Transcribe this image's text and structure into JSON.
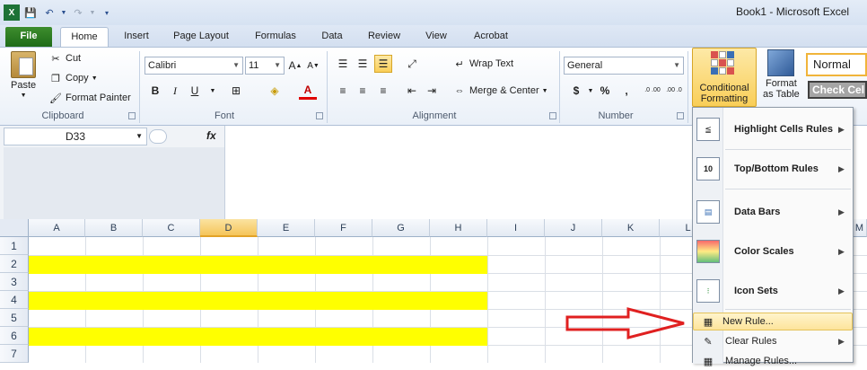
{
  "window": {
    "title": "Book1  -  Microsoft Excel"
  },
  "qat": {
    "app_icon": "excel-icon",
    "save": "save-icon",
    "undo": "undo-icon",
    "redo": "redo-icon",
    "customize": "customize-qat-icon"
  },
  "tabs": [
    "File",
    "Home",
    "Insert",
    "Page Layout",
    "Formulas",
    "Data",
    "Review",
    "View",
    "Acrobat"
  ],
  "ribbon": {
    "clipboard": {
      "paste": "Paste",
      "cut": "Cut",
      "copy": "Copy",
      "format_painter": "Format Painter",
      "label": "Clipboard"
    },
    "font": {
      "name": "Calibri",
      "size": "11",
      "bold": "B",
      "italic": "I",
      "underline": "U",
      "font_color_letter": "A",
      "label": "Font"
    },
    "alignment": {
      "wrap_text": "Wrap Text",
      "merge_center": "Merge & Center",
      "label": "Alignment"
    },
    "number": {
      "format": "General",
      "currency": "$",
      "percent": "%",
      "comma": ",",
      "inc_decimal": ".0 .00",
      "dec_decimal": ".00 .0",
      "label": "Number"
    },
    "styles": {
      "conditional_formatting_line1": "Conditional",
      "conditional_formatting_line2": "Formatting",
      "format_as_table_line1": "Format",
      "format_as_table_line2": "as Table",
      "normal": "Normal",
      "check_cell": "Check Cel"
    }
  },
  "formula_bar": {
    "name_box": "D33",
    "fx": "fx",
    "value": ""
  },
  "grid": {
    "columns": [
      "A",
      "B",
      "C",
      "D",
      "E",
      "F",
      "G",
      "H",
      "I",
      "J",
      "K",
      "L",
      "M"
    ],
    "rows": [
      "1",
      "2",
      "3",
      "4",
      "5",
      "6",
      "7"
    ],
    "highlight_color": "#FFFF00",
    "highlighted_rows": [
      "2",
      "4",
      "6"
    ],
    "selected_column": "D"
  },
  "menu": {
    "items": [
      {
        "label": "Highlight Cells Rules",
        "icon": "highlight-cells-icon",
        "submenu": true
      },
      {
        "label": "Top/Bottom Rules",
        "icon": "top-bottom-icon",
        "submenu": true
      },
      {
        "label": "Data Bars",
        "icon": "data-bars-icon",
        "submenu": true
      },
      {
        "label": "Color Scales",
        "icon": "color-scales-icon",
        "submenu": true
      },
      {
        "label": "Icon Sets",
        "icon": "icon-sets-icon",
        "submenu": true
      },
      {
        "label": "New Rule...",
        "icon": "new-rule-icon",
        "submenu": false
      },
      {
        "label": "Clear Rules",
        "icon": "clear-rules-icon",
        "submenu": true
      },
      {
        "label": "Manage Rules...",
        "icon": "manage-rules-icon",
        "submenu": false
      }
    ]
  },
  "annotation": {
    "arrow_color": "#E02020"
  }
}
